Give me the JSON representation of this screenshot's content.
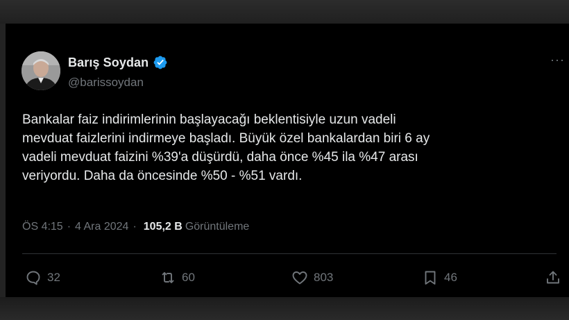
{
  "tweet": {
    "author": {
      "display_name": "Barış Soydan",
      "handle": "@barissoydan",
      "verified": true
    },
    "text_lines": [
      "Bankalar faiz indirimlerinin başlayacağı beklentisiyle uzun vadeli",
      "mevduat faizlerini indirmeye başladı. Büyük özel bankalardan biri 6 ay",
      "vadeli mevduat faizini %39'a düşürdü, daha önce %45 ila %47 arası",
      "veriyordu. Daha da öncesinde %50 - %51 vardı."
    ],
    "time": "ÖS 4:15",
    "date": "4 Ara 2024",
    "separator": "·",
    "views_count": "105,2 B",
    "views_label": "Görüntüleme",
    "more_label": "···",
    "actions": {
      "replies": "32",
      "reposts": "60",
      "likes": "803",
      "bookmarks": "46"
    }
  },
  "icons": {
    "verified": "verified-badge-icon",
    "reply": "reply-icon",
    "repost": "repost-icon",
    "like": "heart-icon",
    "bookmark": "bookmark-icon",
    "share": "share-icon",
    "more": "more-icon"
  },
  "colors": {
    "background": "#000000",
    "text": "#e7e9ea",
    "secondary_text": "#71767b",
    "verified_blue": "#1d9bf0"
  }
}
